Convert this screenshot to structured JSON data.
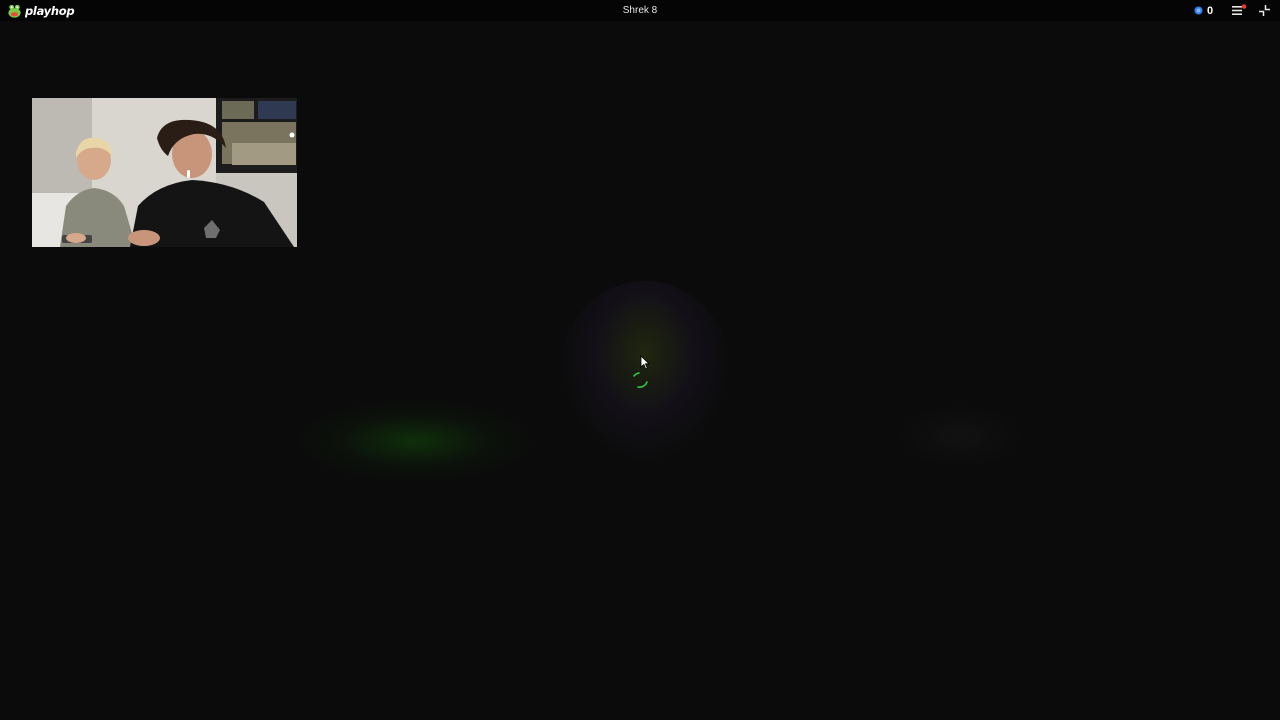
{
  "app": {
    "brand": "playhop",
    "title": "Shrek 8"
  },
  "header": {
    "coins": "0",
    "icons": {
      "logo": "playhop-logo-icon",
      "coin": "coin-icon",
      "menu": "menu-icon",
      "exit": "exit-fullscreen-icon"
    }
  },
  "stage": {
    "loading": "loading-spinner",
    "webcam": "webcam-overlay"
  },
  "colors": {
    "background": "#0b0b0b",
    "topbar": "#050505",
    "coin": "#2f80ed",
    "notification": "#e53935",
    "spinner": "#2ecc40"
  }
}
